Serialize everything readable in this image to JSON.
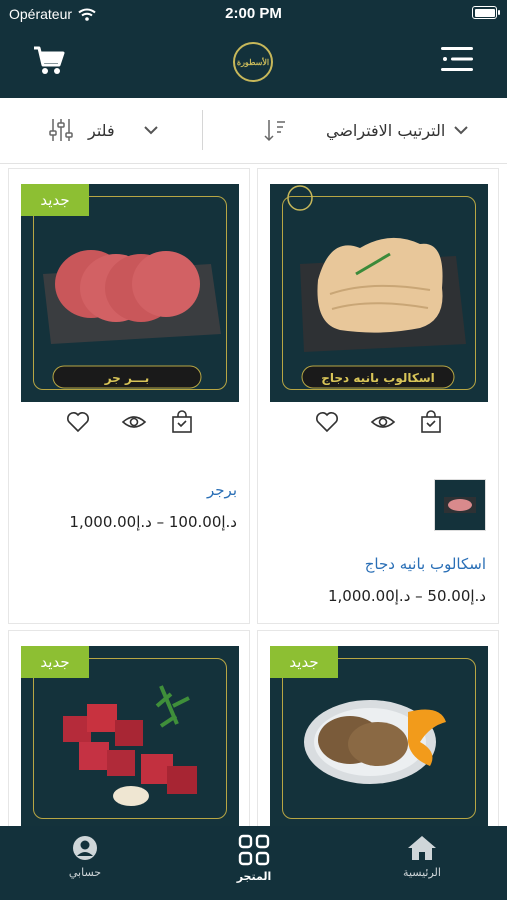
{
  "status_bar": {
    "carrier": "Opérateur",
    "time": "2:00 PM"
  },
  "header": {
    "logo_text": "الأسطورة",
    "cart_icon": "cart-icon",
    "menu_icon": "menu-icon"
  },
  "toolbar": {
    "sort_label": "الترتيب الافتراضي",
    "filter_label": "فلتر"
  },
  "products": [
    {
      "name": "اسكالوب بانيه دجاج",
      "price_range": "د.إ50.00 – د.إ1,000.00",
      "image_caption": "اسكالوب بانيه دجاج",
      "badge": ""
    },
    {
      "name": "برجر",
      "price_range": "د.إ100.00 – د.إ1,000.00",
      "image_caption": "بـــر جر",
      "badge": "جديد"
    },
    {
      "name": "",
      "price_range": "",
      "image_caption": "",
      "badge": "جديد"
    },
    {
      "name": "",
      "price_range": "",
      "image_caption": "",
      "badge": "جديد"
    }
  ],
  "bottom_nav": {
    "items": [
      {
        "label": "حسابي",
        "icon": "account-icon"
      },
      {
        "label": "المتجر",
        "icon": "store-grid-icon"
      },
      {
        "label": "الرئيسية",
        "icon": "home-icon"
      }
    ]
  },
  "colors": {
    "primary": "#13313b",
    "badge": "#8dbf33",
    "link": "#2a6fb6",
    "gold": "#c7b85a"
  }
}
